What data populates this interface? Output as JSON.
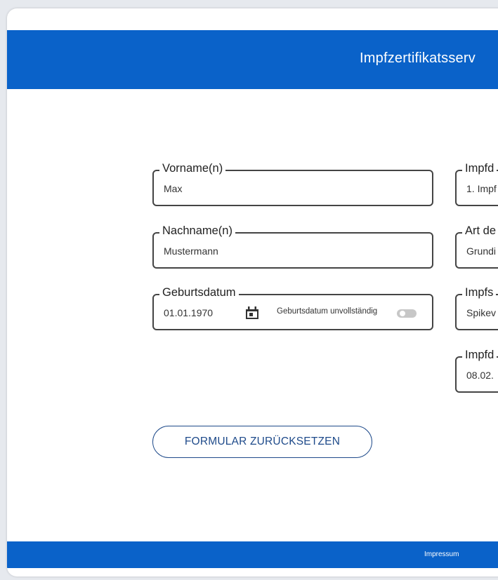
{
  "header": {
    "title": "Impfzertifikatsserv"
  },
  "left_form": {
    "first_name": {
      "label": "Vorname(n)",
      "value": "Max"
    },
    "last_name": {
      "label": "Nachname(n)",
      "value": "Mustermann"
    },
    "birthdate": {
      "label": "Geburtsdatum",
      "value": "01.01.1970",
      "icon": "calendar-icon",
      "toggle_label": "Geburtsdatum unvollständig",
      "toggle_on": false
    }
  },
  "right_form": {
    "dose": {
      "label": "Impfd",
      "value": "1. Impf"
    },
    "type": {
      "label": "Art de",
      "value": "Grundi"
    },
    "vaccine": {
      "label": "Impfs",
      "value": "Spikev"
    },
    "date": {
      "label": "Impfd",
      "value": "08.02."
    }
  },
  "actions": {
    "reset_label": "FORMULAR ZURÜCKSETZEN"
  },
  "footer": {
    "impressum_label": "Impressum"
  },
  "colors": {
    "primary": "#0a62c9",
    "button_text": "#1e4a8a"
  }
}
